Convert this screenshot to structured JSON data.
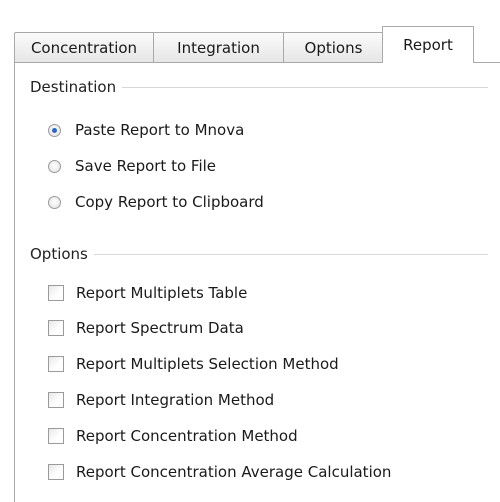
{
  "tabs": [
    {
      "label": "Concentration",
      "active": false
    },
    {
      "label": "Integration",
      "active": false
    },
    {
      "label": "Options",
      "active": false
    },
    {
      "label": "Report",
      "active": true
    }
  ],
  "destination": {
    "title": "Destination",
    "options": [
      {
        "label": "Paste Report to Mnova",
        "selected": true
      },
      {
        "label": "Save Report to File",
        "selected": false
      },
      {
        "label": "Copy Report to Clipboard",
        "selected": false
      }
    ]
  },
  "options": {
    "title": "Options",
    "checkboxes": [
      {
        "label": "Report Multiplets Table",
        "checked": false
      },
      {
        "label": "Report Spectrum Data",
        "checked": false
      },
      {
        "label": "Report Multiplets Selection Method",
        "checked": false
      },
      {
        "label": "Report Integration Method",
        "checked": false
      },
      {
        "label": "Report Concentration Method",
        "checked": false
      },
      {
        "label": "Report Concentration Average Calculation",
        "checked": false
      }
    ]
  },
  "colors": {
    "radio_selected": "#2a66c8",
    "border": "#a9a9a9"
  }
}
